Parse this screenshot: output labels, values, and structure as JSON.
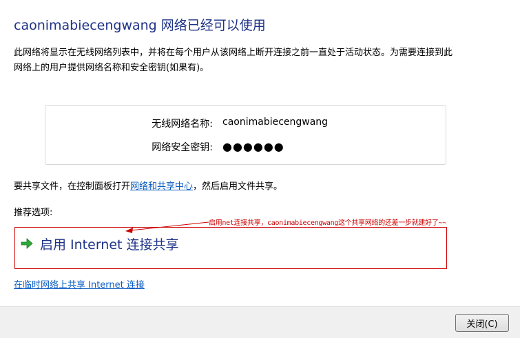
{
  "header": {
    "title": "caonimabiecengwang 网络已经可以使用"
  },
  "description": "此网络将显示在无线网络列表中，并将在每个用户从该网络上断开连接之前一直处于活动状态。为需要连接到此网络上的用户提供网络名称和安全密钥(如果有)。",
  "network_info": {
    "name_label": "无线网络名称:",
    "name_value": "caonimabiecengwang",
    "key_label": "网络安全密钥:",
    "key_value": "●●●●●●"
  },
  "share": {
    "prefix": "要共享文件，在控制面板打开",
    "link": "网络和共享中心",
    "suffix": "，然后启用文件共享。"
  },
  "recommended_label": "推荐选项:",
  "option_ics": {
    "label": "启用 Internet 连接共享",
    "icon": "green-arrow-icon"
  },
  "annotation": {
    "text": "启用net连接共享，caonimabiecengwang这个共享网络的还差一步就建好了~~",
    "color": "#cc0000"
  },
  "adhoc_link": "在临时网络上共享 Internet 连接",
  "footer": {
    "close_label": "关闭(C)"
  },
  "colors": {
    "title": "#1e3287",
    "link": "#0a5cc2",
    "footer_bg": "#f0f0f0"
  }
}
